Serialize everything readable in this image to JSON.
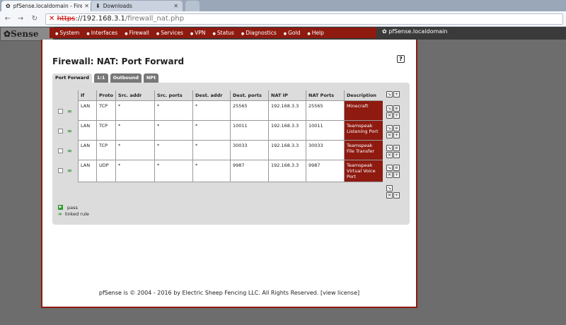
{
  "browser": {
    "tabs": [
      {
        "title": "pfSense.localdomain - Firewa",
        "active": true
      },
      {
        "title": "Downloads",
        "active": false
      }
    ],
    "url": {
      "scheme": "https",
      "separator": "://",
      "host": "192.168.3.1",
      "path": "/firewall_nat.php"
    }
  },
  "header": {
    "logo": "Sense",
    "menu": [
      "System",
      "Interfaces",
      "Firewall",
      "Services",
      "VPN",
      "Status",
      "Diagnostics",
      "Gold",
      "Help"
    ],
    "hostname": "pfSense.localdomain"
  },
  "page": {
    "title": "Firewall: NAT: Port Forward",
    "tabs": [
      "Port Forward",
      "1:1",
      "Outbound",
      "NPt"
    ],
    "table": {
      "columns": [
        "If",
        "Proto",
        "Src. addr",
        "Src. ports",
        "Dest. addr",
        "Dest. ports",
        "NAT IP",
        "NAT Ports",
        "Description"
      ],
      "rows": [
        {
          "if": "LAN",
          "proto": "TCP",
          "src_addr": "*",
          "src_ports": "*",
          "dest_addr": "*",
          "dest_ports": "25565",
          "nat_ip": "192.168.3.3",
          "nat_ports": "25565",
          "description": "Minecraft"
        },
        {
          "if": "LAN",
          "proto": "TCP",
          "src_addr": "*",
          "src_ports": "*",
          "dest_addr": "*",
          "dest_ports": "10011",
          "nat_ip": "192.168.3.3",
          "nat_ports": "10011",
          "description": "Teamspeak Listening Port"
        },
        {
          "if": "LAN",
          "proto": "TCP",
          "src_addr": "*",
          "src_ports": "*",
          "dest_addr": "*",
          "dest_ports": "30033",
          "nat_ip": "192.168.3.3",
          "nat_ports": "30033",
          "description": "Teamspeak File Transfer"
        },
        {
          "if": "LAN",
          "proto": "UDP",
          "src_addr": "*",
          "src_ports": "*",
          "dest_addr": "*",
          "dest_ports": "9987",
          "nat_ip": "192.168.3.3",
          "nat_ports": "9987",
          "description": "Teamspeak Virtual Voice Port"
        }
      ]
    },
    "legend": {
      "pass": "pass",
      "linked": "linked rule"
    },
    "footer": {
      "prefix": "pfSense",
      "text": " is © 2004 - 2016 by Electric Sheep Fencing LLC. All Rights Reserved. [",
      "link": "view license",
      "suffix": "]"
    }
  },
  "colors": {
    "accent": "#8e1a10",
    "panel": "#dcdcdc",
    "pass": "#2e9b2e"
  }
}
